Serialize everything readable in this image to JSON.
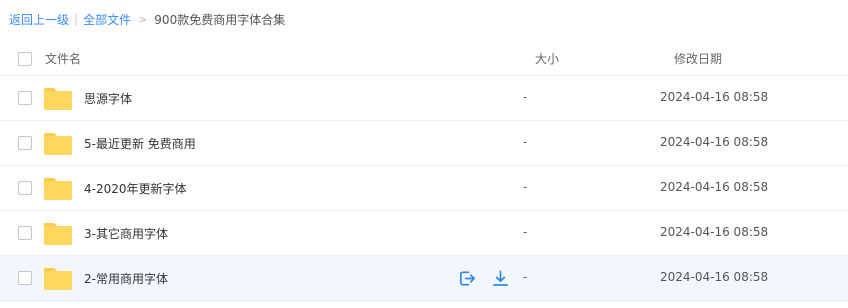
{
  "breadcrumb": {
    "back": "返回上一级",
    "separator": "|",
    "all_files": "全部文件",
    "arrow": ">",
    "current": "900款免费商用字体合集"
  },
  "header": {
    "name": "文件名",
    "size": "大小",
    "date": "修改日期"
  },
  "rows": [
    {
      "name": "思源字体",
      "size": "-",
      "date": "2024-04-16 08:58"
    },
    {
      "name": "5-最近更新 免费商用",
      "size": "-",
      "date": "2024-04-16 08:58"
    },
    {
      "name": "4-2020年更新字体",
      "size": "-",
      "date": "2024-04-16 08:58"
    },
    {
      "name": "3-其它商用字体",
      "size": "-",
      "date": "2024-04-16 08:58"
    },
    {
      "name": "2-常用商用字体",
      "size": "-",
      "date": "2024-04-16 08:58"
    }
  ],
  "icons": {
    "folder": "folder-icon",
    "share": "share-icon",
    "download": "download-icon"
  },
  "colors": {
    "link": "#3b8cff",
    "folder": "#ffd75e",
    "hover_row": "#f2f7ff",
    "action_icon": "#2f8ae6"
  }
}
